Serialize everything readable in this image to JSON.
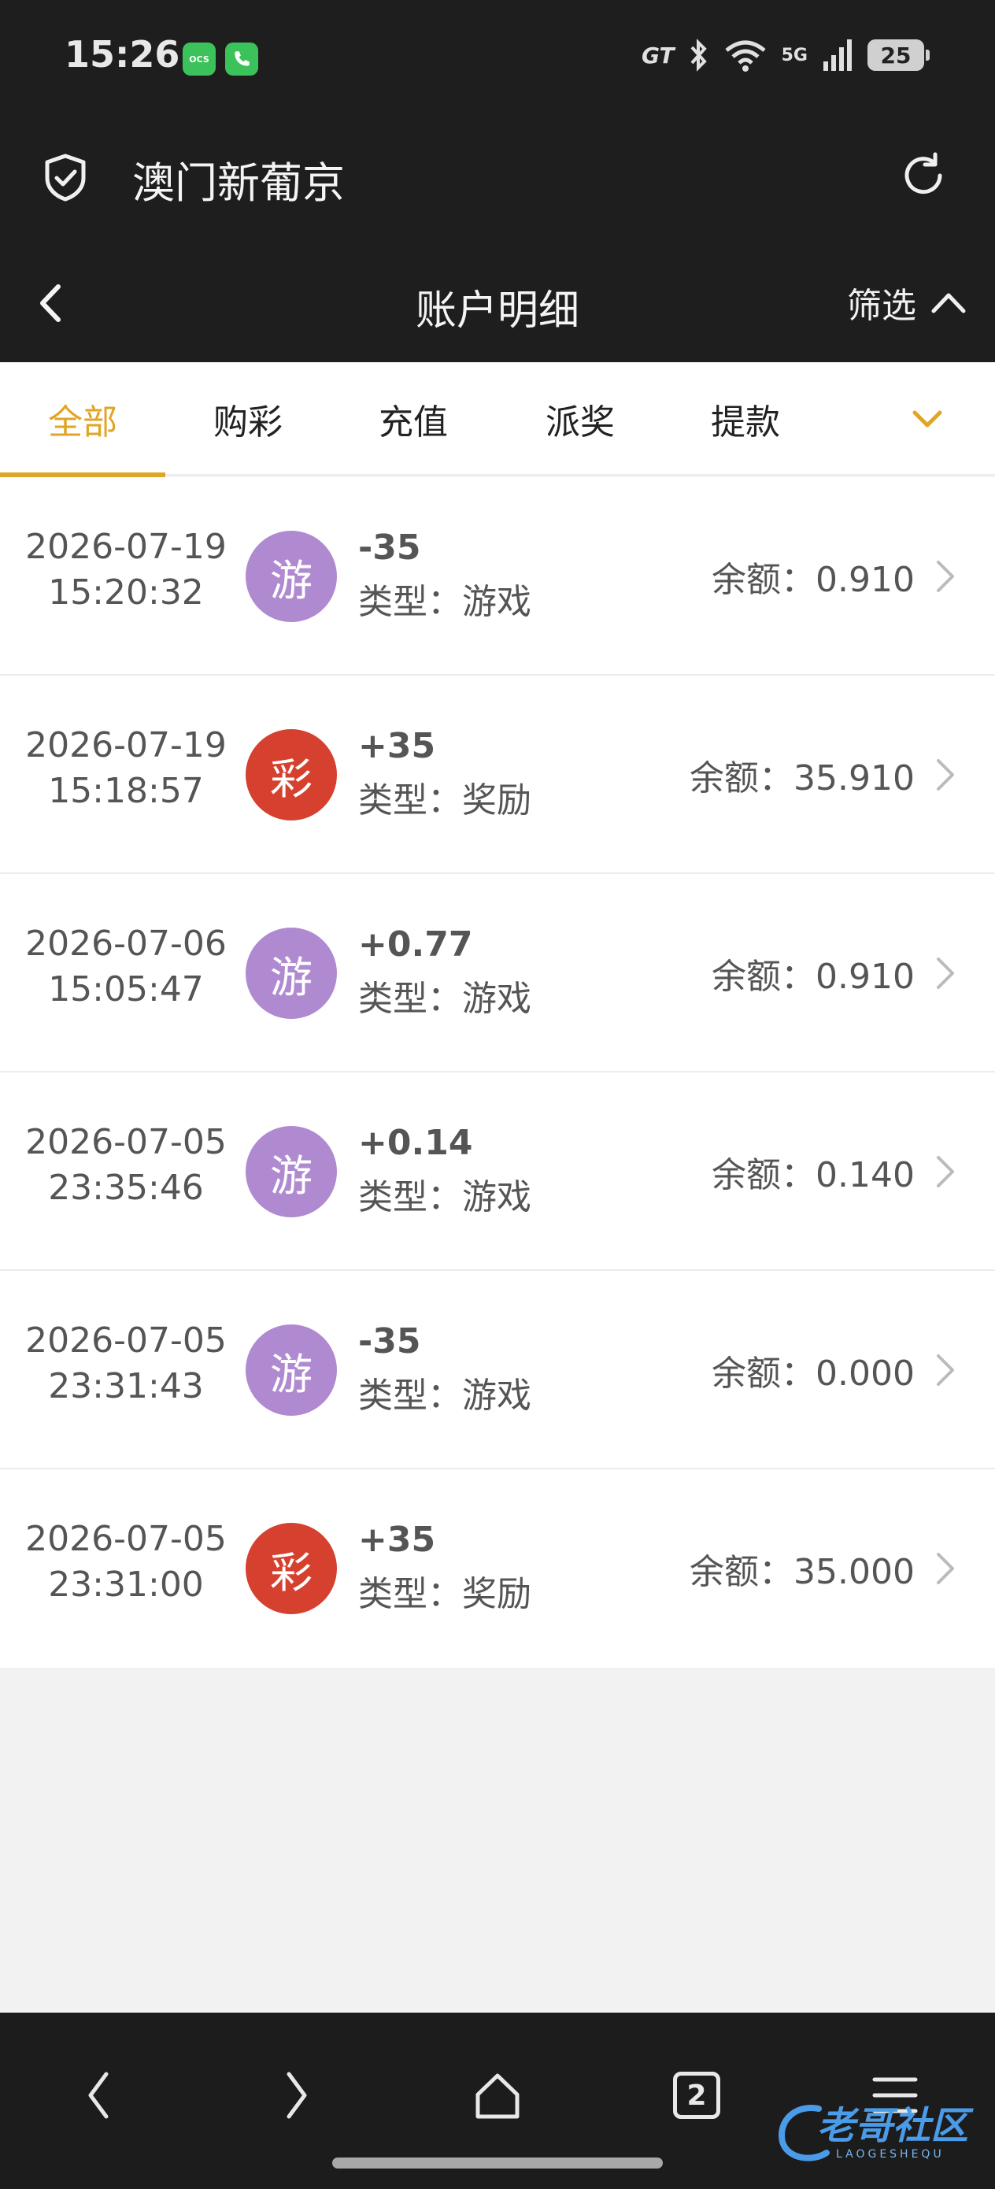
{
  "status_bar": {
    "time": "15:26",
    "app_badge_1": "OCS",
    "carrier_mark": "GT",
    "network": "5G",
    "battery": "25"
  },
  "browser": {
    "site_title": "澳门新葡京"
  },
  "header": {
    "title": "账户明细",
    "filter_label": "筛选"
  },
  "tabs": [
    {
      "label": "全部",
      "active": true
    },
    {
      "label": "购彩",
      "active": false
    },
    {
      "label": "充值",
      "active": false
    },
    {
      "label": "派奖",
      "active": false
    },
    {
      "label": "提款",
      "active": false
    }
  ],
  "records": [
    {
      "date": "2026-07-19",
      "time": "15:20:32",
      "badge": "游",
      "badge_color": "#b08ad0",
      "amount": "-35",
      "type": "类型：游戏",
      "balance": "余额：0.910"
    },
    {
      "date": "2026-07-19",
      "time": "15:18:57",
      "badge": "彩",
      "badge_color": "#d6402e",
      "amount": "+35",
      "type": "类型：奖励",
      "balance": "余额：35.910"
    },
    {
      "date": "2026-07-06",
      "time": "15:05:47",
      "badge": "游",
      "badge_color": "#b08ad0",
      "amount": "+0.77",
      "type": "类型：游戏",
      "balance": "余额：0.910"
    },
    {
      "date": "2026-07-05",
      "time": "23:35:46",
      "badge": "游",
      "badge_color": "#b08ad0",
      "amount": "+0.14",
      "type": "类型：游戏",
      "balance": "余额：0.140"
    },
    {
      "date": "2026-07-05",
      "time": "23:31:43",
      "badge": "游",
      "badge_color": "#b08ad0",
      "amount": "-35",
      "type": "类型：游戏",
      "balance": "余额：0.000"
    },
    {
      "date": "2026-07-05",
      "time": "23:31:00",
      "badge": "彩",
      "badge_color": "#d6402e",
      "amount": "+35",
      "type": "类型：奖励",
      "balance": "余额：35.000"
    }
  ],
  "bottom_bar": {
    "tab_count": "2"
  },
  "watermark": {
    "text": "老哥社区",
    "sub": "LAOGESHEQU"
  },
  "colors": {
    "accent": "#e0a526",
    "header_bg": "#1e1e1e"
  }
}
